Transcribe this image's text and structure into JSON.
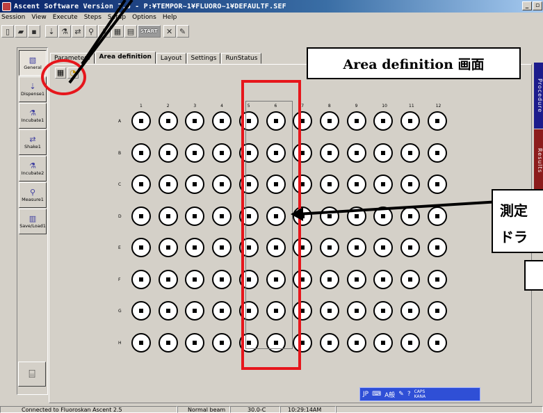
{
  "window": {
    "title": "Ascent Software Version 2.6 - P:¥TEMPOR~1¥FLUORO~1¥DEFAULTF.SEF"
  },
  "menu": [
    "Session",
    "View",
    "Execute",
    "Steps",
    "Setup",
    "Options",
    "Help"
  ],
  "toolbar": {
    "start_label": "START"
  },
  "steps": [
    "General",
    "Dispense1",
    "Incubate1",
    "Shake1",
    "Incubate2",
    "Measure1",
    "Save/Load1"
  ],
  "tabs": [
    "Parameters",
    "Area definition",
    "Layout",
    "Settings",
    "RunStatus"
  ],
  "plate": {
    "columns": [
      "1",
      "2",
      "3",
      "4",
      "5",
      "6",
      "7",
      "8",
      "9",
      "10",
      "11",
      "12"
    ],
    "rows": [
      "A",
      "B",
      "C",
      "D",
      "E",
      "F",
      "G",
      "H"
    ]
  },
  "annotations": {
    "callout_title": "Area definition 画面",
    "callout_side_1": "測定",
    "callout_side_2": "ドラ"
  },
  "side_tabs": [
    "Procedure",
    "Results"
  ],
  "ime": {
    "lang": "JP",
    "mode": "A般",
    "caps": "CAPS",
    "kana": "KANA"
  },
  "status": {
    "connection": "Connected to Fluoroskan Ascent 2.5",
    "beam": "Normal beam",
    "temperature": "30.0-C",
    "time": "10:29:14AM"
  },
  "colors": {
    "annotation_red": "#e6161c",
    "titlebar_blue": "#0a246a",
    "ime_blue": "#2f4fd6"
  }
}
